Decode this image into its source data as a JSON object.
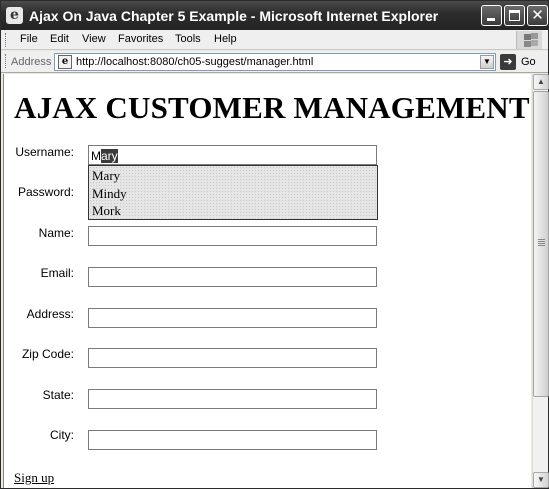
{
  "window": {
    "title": "Ajax On Java Chapter 5 Example - Microsoft Internet Explorer"
  },
  "menu": {
    "items": [
      "File",
      "Edit",
      "View",
      "Favorites",
      "Tools",
      "Help"
    ]
  },
  "address_bar": {
    "label": "Address",
    "url": "http://localhost:8080/ch05-suggest/manager.html",
    "go_label": "Go"
  },
  "page": {
    "heading": "AJAX CUSTOMER MANAGEMENT",
    "username": {
      "label": "Username:",
      "typed_prefix": "M",
      "selected_completion": "ary"
    },
    "suggestions": [
      "Mary",
      "Mindy",
      "Mork"
    ],
    "fields": [
      {
        "label": "Password:",
        "value": ""
      },
      {
        "label": "Name:",
        "value": ""
      },
      {
        "label": "Email:",
        "value": ""
      },
      {
        "label": "Address:",
        "value": ""
      },
      {
        "label": "Zip Code:",
        "value": ""
      },
      {
        "label": "State:",
        "value": ""
      },
      {
        "label": "City:",
        "value": ""
      }
    ],
    "signup_link": "Sign up"
  }
}
